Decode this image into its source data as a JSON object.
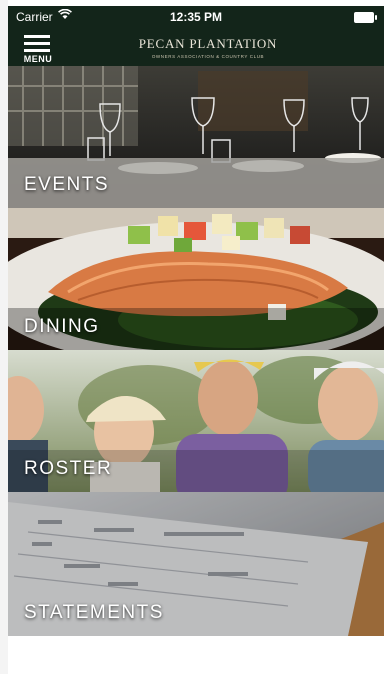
{
  "status_bar": {
    "carrier": "Carrier",
    "time": "12:35 PM"
  },
  "nav": {
    "menu_label": "MENU",
    "brand_name": "PECAN PLANTATION",
    "brand_tagline": "OWNERS ASSOCIATION & COUNTRY CLUB"
  },
  "tiles": [
    {
      "label": "EVENTS"
    },
    {
      "label": "DINING"
    },
    {
      "label": "ROSTER"
    },
    {
      "label": "STATEMENTS"
    }
  ],
  "colors": {
    "nav_background": "#13251a",
    "tile_label": "#ffffff"
  }
}
